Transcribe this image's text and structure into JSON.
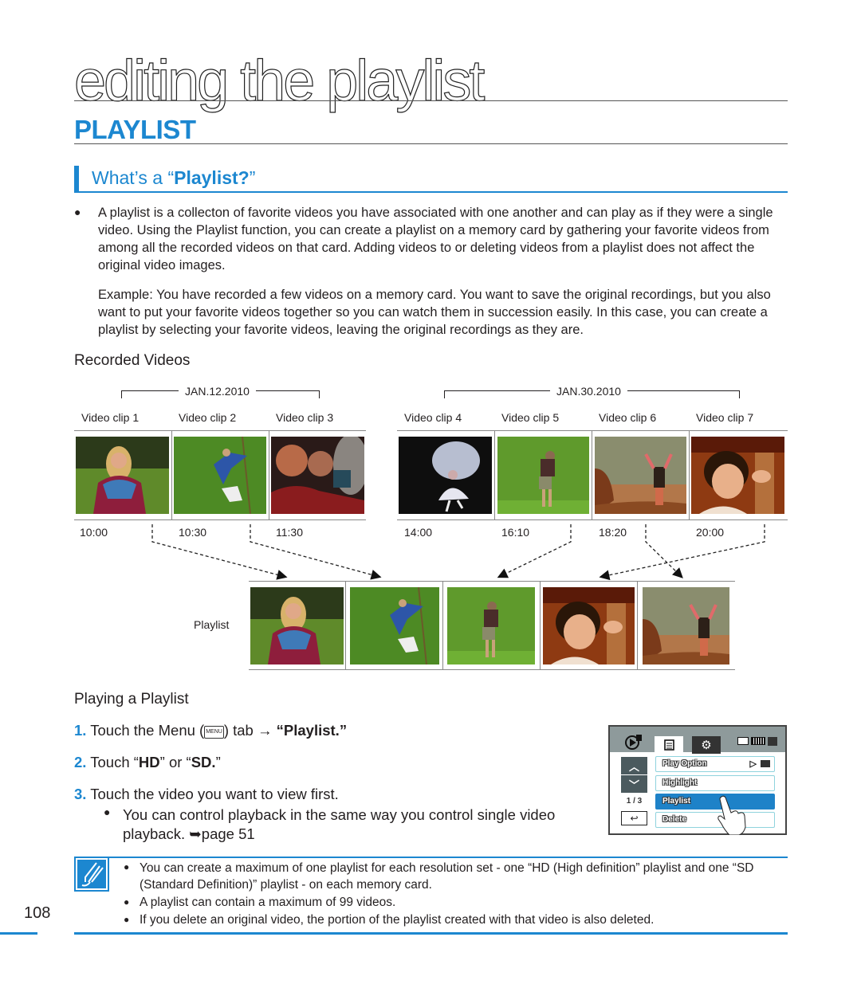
{
  "header": {
    "chapter_title": "editing the playlist",
    "section_title": "PLAYLIST",
    "subsection_prefix": "What’s a “",
    "subsection_bold": "Playlist?",
    "subsection_suffix": "”"
  },
  "intro": {
    "bullet": "A playlist is a collecton of favorite videos you have associated with one another and can play as if they were a single video. Using the Playlist function, you can create a playlist on a memory card by gathering your favorite videos from among all the recorded videos on that card. Adding videos to or deleting videos from a playlist does not affect the original video images.",
    "example": "Example: You have recorded a few videos on a memory card. You want to save the original recordings, but you also want to put your favorite videos together so you can watch them in succession easily. In this case, you can create a playlist by selecting your favorite videos, leaving the original recordings as they are."
  },
  "recorded": {
    "heading": "Recorded Videos",
    "groups": [
      {
        "date": "JAN.12.2010",
        "clips": [
          {
            "label": "Video clip 1",
            "time": "10:00",
            "subject": "woman-jogging"
          },
          {
            "label": "Video clip 2",
            "time": "10:30",
            "subject": "man-kicking-ball"
          },
          {
            "label": "Video clip 3",
            "time": "11:30",
            "subject": "two-men-smiling"
          }
        ]
      },
      {
        "date": "JAN.30.2010",
        "clips": [
          {
            "label": "Video clip 4",
            "time": "14:00",
            "subject": "girl-with-umbrella"
          },
          {
            "label": "Video clip 5",
            "time": "16:10",
            "subject": "golfer-swinging"
          },
          {
            "label": "Video clip 6",
            "time": "18:20",
            "subject": "hiker-arms-raised"
          },
          {
            "label": "Video clip 7",
            "time": "20:00",
            "subject": "woman-smiling"
          }
        ]
      }
    ]
  },
  "playlist_row": {
    "label": "Playlist",
    "items": [
      "woman-jogging",
      "man-kicking-ball",
      "golfer-swinging",
      "woman-smiling",
      "hiker-arms-raised"
    ]
  },
  "playing": {
    "heading": "Playing a Playlist",
    "steps": [
      {
        "num": "1.",
        "pre": "Touch the Menu (",
        "key": "MENU",
        "mid": ") tab → ",
        "bold": "“Playlist.”"
      },
      {
        "num": "2.",
        "pre": "Touch “",
        "bold1": "HD",
        "mid": "” or “",
        "bold2": "SD.",
        "post": "”"
      },
      {
        "num": "3.",
        "text": "Touch the video you want to view first."
      }
    ],
    "sub_bullet": "You can control playback in the same way you control single video playback. ➥page 51"
  },
  "camera_screen": {
    "page_indicator": "1 / 3",
    "menu_items": [
      {
        "label": "Play Option",
        "selected": false
      },
      {
        "label": "Highlight",
        "selected": false
      },
      {
        "label": "Playlist",
        "selected": true
      },
      {
        "label": "Delete",
        "selected": false
      }
    ]
  },
  "notes": [
    "You can create a maximum of one playlist for each resolution set - one “HD (High definition” playlist and one “SD (Standard Definition)” playlist - on each memory card.",
    "A playlist can contain a maximum of 99 videos.",
    "If you delete an original video, the portion of the playlist created with that video is also deleted."
  ],
  "page_number": "108",
  "colors": {
    "accent": "#1c87d0",
    "selected_row": "#1e82c8"
  }
}
